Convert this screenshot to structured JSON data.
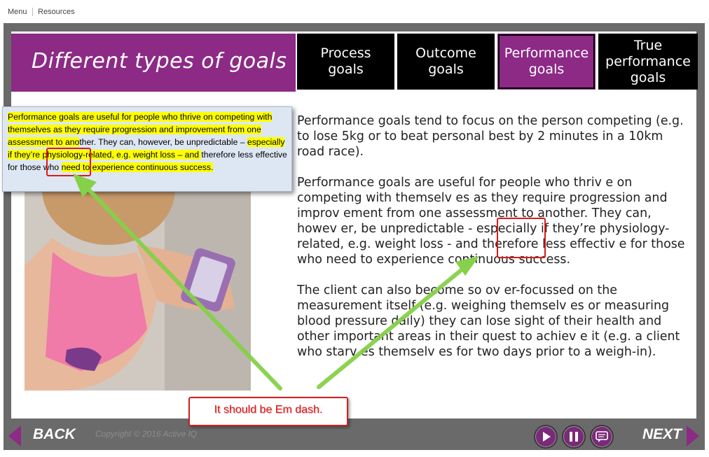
{
  "topbar": {
    "menu": "Menu",
    "resources": "Resources"
  },
  "header": {
    "title": "Different types of goals",
    "tabs": [
      {
        "label": "Process\ngoals",
        "active": false
      },
      {
        "label": "Outcome\ngoals",
        "active": false
      },
      {
        "label": "Performance\ngoals",
        "active": true
      },
      {
        "label": "True\nperformance\ngoals",
        "active": false
      }
    ]
  },
  "content": {
    "paragraphs": [
      "Performance goals tend to focus on the person competing (e.g. to lose 5kg or to beat personal best by 2 minutes in a 10km road race).",
      "Performance goals are useful for people who thriv e on competing with themselv es as they require progression and improv ement from one assessment to another. They can, howev er, be unpredictable - especially if they’re physiology-related, e.g. weight loss - and therefore less effectiv e for those who need to experience continuous success.",
      "The client can also become so ov er-focussed on the measurement itself (e.g. weighing themselv es or measuring blood pressure daily) they can lose sight of their health and other important areas in their quest to achiev e it (e.g. a client who starv es themselv es for two days prior to a weigh-in)."
    ]
  },
  "popup": {
    "highlighted_1": "Performance goals are useful for people who thrive on competing with themselves as they require progression and improvement from one assessment to ano",
    "plain_1": "ther. They can, however, be unpredictable – ",
    "highlighted_2": "especially if they’re physiology-related, e.g. weight loss – and ",
    "plain_2": "therefore less effective for those who ",
    "highlighted_3": "need to experience continuous success."
  },
  "annotation": {
    "callout": "It should be Em dash."
  },
  "footer": {
    "back": "BACK",
    "next": "NEXT",
    "copyright": "Copyright © 2016 Active IQ"
  },
  "colors": {
    "brand_purple": "#8c2a86",
    "annotation_red": "#d91b1b",
    "arrow_green": "#86d04a",
    "highlight_yellow": "#ffff00"
  },
  "icons": [
    "play-icon",
    "pause-icon",
    "transcript-icon",
    "back-arrow-icon",
    "next-arrow-icon"
  ]
}
